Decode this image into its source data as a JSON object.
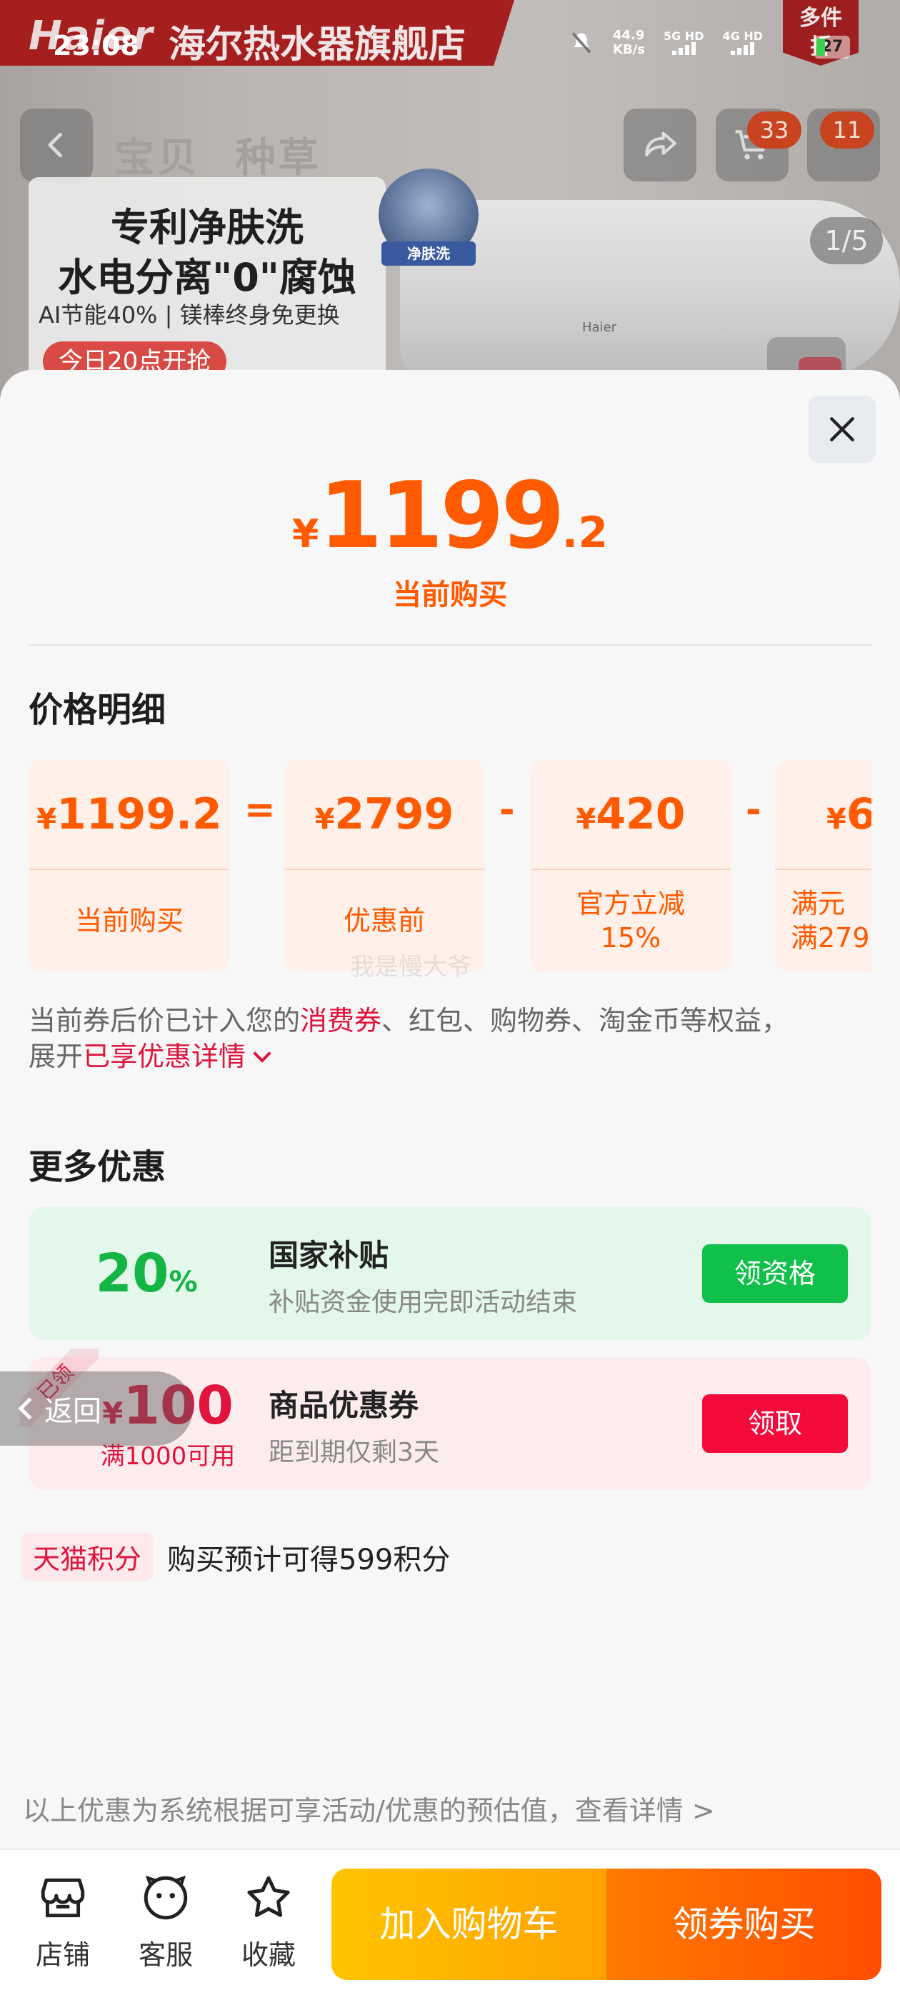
{
  "background": {
    "status": {
      "time": "23:08",
      "net_speed_value": "44.9",
      "net_speed_unit": "KB/s",
      "sim1": "5G HD",
      "sim2": "4G HD",
      "battery": "27"
    },
    "store_banner": {
      "brand": "Haier",
      "store_name": "海尔热水器旗舰店",
      "multi_tag_line1": "多件",
      "multi_tag_line2": "折"
    },
    "tabs": [
      "宝贝",
      "种草"
    ],
    "cart_count": "33",
    "message_count": "11",
    "image_counter": "1/5",
    "promo": {
      "line1": "专利净肤洗",
      "line2": "水电分离\"0\"腐蚀",
      "line3": "AI节能40% | 镁棒终身免更换",
      "line4": "今日20点开抢"
    },
    "heater_logo": "Haier",
    "heater_badge": "净肤洗"
  },
  "sheet": {
    "price": {
      "currency": "¥",
      "integer": "1199",
      "decimal": ".2",
      "label": "当前购买"
    },
    "price_detail_title": "价格明细",
    "breakdown": [
      {
        "currency": "¥",
        "value": "1199.2",
        "label": "当前购买"
      },
      {
        "currency": "¥",
        "value": "2799",
        "label": "优惠前"
      },
      {
        "currency": "¥",
        "value": "420",
        "label": "官方立减\n15%"
      },
      {
        "currency": "¥",
        "value": "6",
        "label": "满元\n满279"
      }
    ],
    "operators": [
      "=",
      "-",
      "-"
    ],
    "watermark": "我是慢大爷",
    "note": {
      "part1": "当前券后价已计入您的",
      "highlight1": "消费券",
      "part2": "、红包、购物券、淘金币等权益，",
      "part3": "展开",
      "highlight2": "已享优惠详情"
    },
    "more_offers_title": "更多优惠",
    "gov_subsidy": {
      "percent": "20",
      "unit": "%",
      "title": "国家补贴",
      "subtitle": "补贴资金使用完即活动结束",
      "button": "领资格"
    },
    "coupon": {
      "claimed_tag": "已领",
      "currency": "¥",
      "amount": "100",
      "condition": "满1000可用",
      "title": "商品优惠券",
      "subtitle": "距到期仅剩3天",
      "button": "领取"
    },
    "return_label": "返回",
    "points": {
      "tag": "天猫积分",
      "text": "购买预计可得599积分"
    },
    "disclaimer": "以上优惠为系统根据可享活动/优惠的预估值，查看详情 >"
  },
  "bottom_bar": {
    "store": "店铺",
    "service": "客服",
    "favorite": "收藏",
    "add_to_cart": "加入购物车",
    "buy_with_coupon": "领券购买"
  },
  "colors": {
    "accent_orange": "#ff5a00",
    "accent_red": "#e0143c",
    "accent_green": "#14b545"
  },
  "icons": [
    "back-icon",
    "share-icon",
    "cart-icon",
    "more-icon",
    "close-icon",
    "store-icon",
    "service-icon",
    "star-icon",
    "chevron-down-icon",
    "bell-mute-icon",
    "wifi-icon"
  ]
}
